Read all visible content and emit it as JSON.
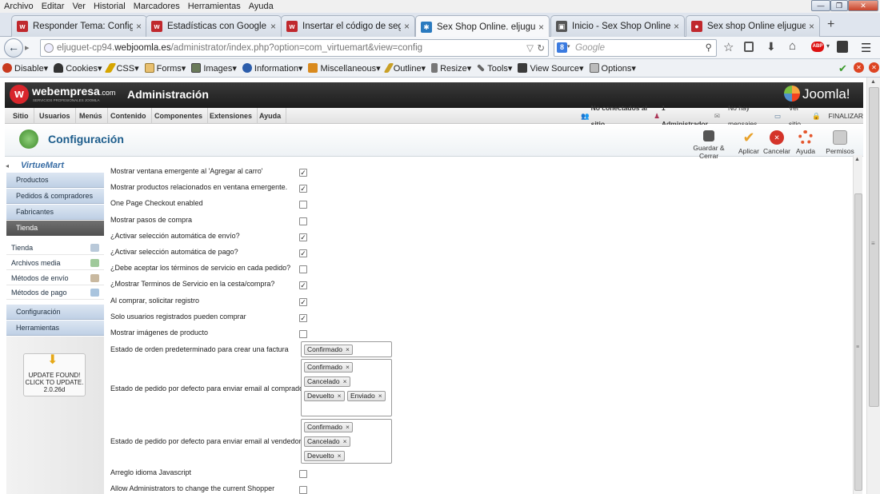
{
  "menubar": {
    "items": [
      "Archivo",
      "Editar",
      "Ver",
      "Historial",
      "Marcadores",
      "Herramientas",
      "Ayuda"
    ]
  },
  "tabs": [
    {
      "title": "Responder Tema: Configur...",
      "fav_color": "#c0282d",
      "active": false
    },
    {
      "title": "Estadísticas con Google An...",
      "fav_color": "#c0282d",
      "active": false
    },
    {
      "title": "Insertar el código de seguí...",
      "fav_color": "#c0282d",
      "active": false
    },
    {
      "title": "Sex Shop Online. eljuguete...",
      "fav_color": "#2a7abf",
      "active": true
    },
    {
      "title": "Inicio - Sex Shop Online. elj...",
      "fav_color": "#555555",
      "active": false
    },
    {
      "title": "Sex shop Online eljugueteee...",
      "fav_color": "#c0282d",
      "active": false
    }
  ],
  "nav": {
    "url_prefix": "eljuguet-cp94.",
    "url_domain": "webjoomla.es",
    "url_path": "/administrator/index.php?option=com_virtuemart&view=config",
    "search_placeholder": "Google"
  },
  "devbar": {
    "items": [
      "Disable▾",
      "Cookies▾",
      "CSS▾",
      "Forms▾",
      "Images▾",
      "Information▾",
      "Miscellaneous▾",
      "Outline▾",
      "Resize▾",
      "Tools▾",
      "View Source▾",
      "Options▾"
    ]
  },
  "joomla": {
    "brand": "webempresa",
    "brand_suffix": ".com",
    "brand_tagline": "SERVICIOS PROFESIONALES JOOMLA",
    "header_title": "Administración",
    "logo_text": "Joomla!",
    "menu": [
      "Sitio",
      "Usuarios",
      "Menús",
      "Contenido",
      "Componentes",
      "Extensiones",
      "Ayuda"
    ],
    "status": {
      "not_connected": "No conectados al sitio",
      "admins": "1 Administrador",
      "messages": "No hay mensajes",
      "view_site": "Ver sitio",
      "logout": "FINALIZAR"
    },
    "page_title": "Configuración",
    "toolbar": {
      "save_close": "Guardar & Cerrar",
      "apply": "Aplicar",
      "cancel": "Cancelar",
      "help": "Ayuda",
      "permissions": "Permisos"
    }
  },
  "sidebar": {
    "logo": "VirtueMart",
    "products": "Productos",
    "orders": "Pedidos & compradores",
    "manufacturers": "Fabricantes",
    "shop": "Tienda",
    "shop_items": [
      "Tienda",
      "Archivos media",
      "Métodos de envío",
      "Métodos de pago"
    ],
    "configuration": "Configuración",
    "tools": "Herramientas",
    "update_l1": "UPDATE FOUND!",
    "update_l2": "CLICK TO UPDATE.",
    "update_l3": "2.0.26d"
  },
  "form": {
    "rows": [
      {
        "label": "Mostrar ventana emergente al 'Agregar al carro'",
        "checked": true
      },
      {
        "label": "Mostrar productos relacionados en ventana emergente.",
        "checked": true
      },
      {
        "label": "One Page Checkout enabled",
        "checked": false
      },
      {
        "label": "Mostrar pasos de compra",
        "checked": false
      },
      {
        "label": "¿Activar selección automática de envío?",
        "checked": true
      },
      {
        "label": "¿Activar selección automática de pago?",
        "checked": true
      },
      {
        "label": "¿Debe aceptar los términos de servicio en cada pedido?",
        "checked": false
      },
      {
        "label": "¿Mostrar Terminos de Servicio en la cesta/compra?",
        "checked": true
      },
      {
        "label": "Al comprar, solicitar registro",
        "checked": true
      },
      {
        "label": "Solo usuarios registrados pueden comprar",
        "checked": true
      },
      {
        "label": "Mostrar imágenes de producto",
        "checked": false
      }
    ],
    "invoice_label": "Estado de orden predeterminado para crear una factura",
    "invoice_tags": [
      "Confirmado"
    ],
    "buyer_label": "Estado de pedido por defecto para enviar email al comprador",
    "buyer_tags": [
      "Confirmado",
      "Cancelado",
      "Devuelto",
      "Enviado"
    ],
    "seller_label": "Estado de pedido por defecto para enviar email al vendedor",
    "seller_tags": [
      "Confirmado",
      "Cancelado",
      "Devuelto"
    ],
    "js_label": "Arreglo idioma Javascript",
    "js_checked": false,
    "admin_label": "Allow Administrators to change the current Shopper",
    "admin_checked": false,
    "tag_remove": "×",
    "check_mark": "✓"
  }
}
